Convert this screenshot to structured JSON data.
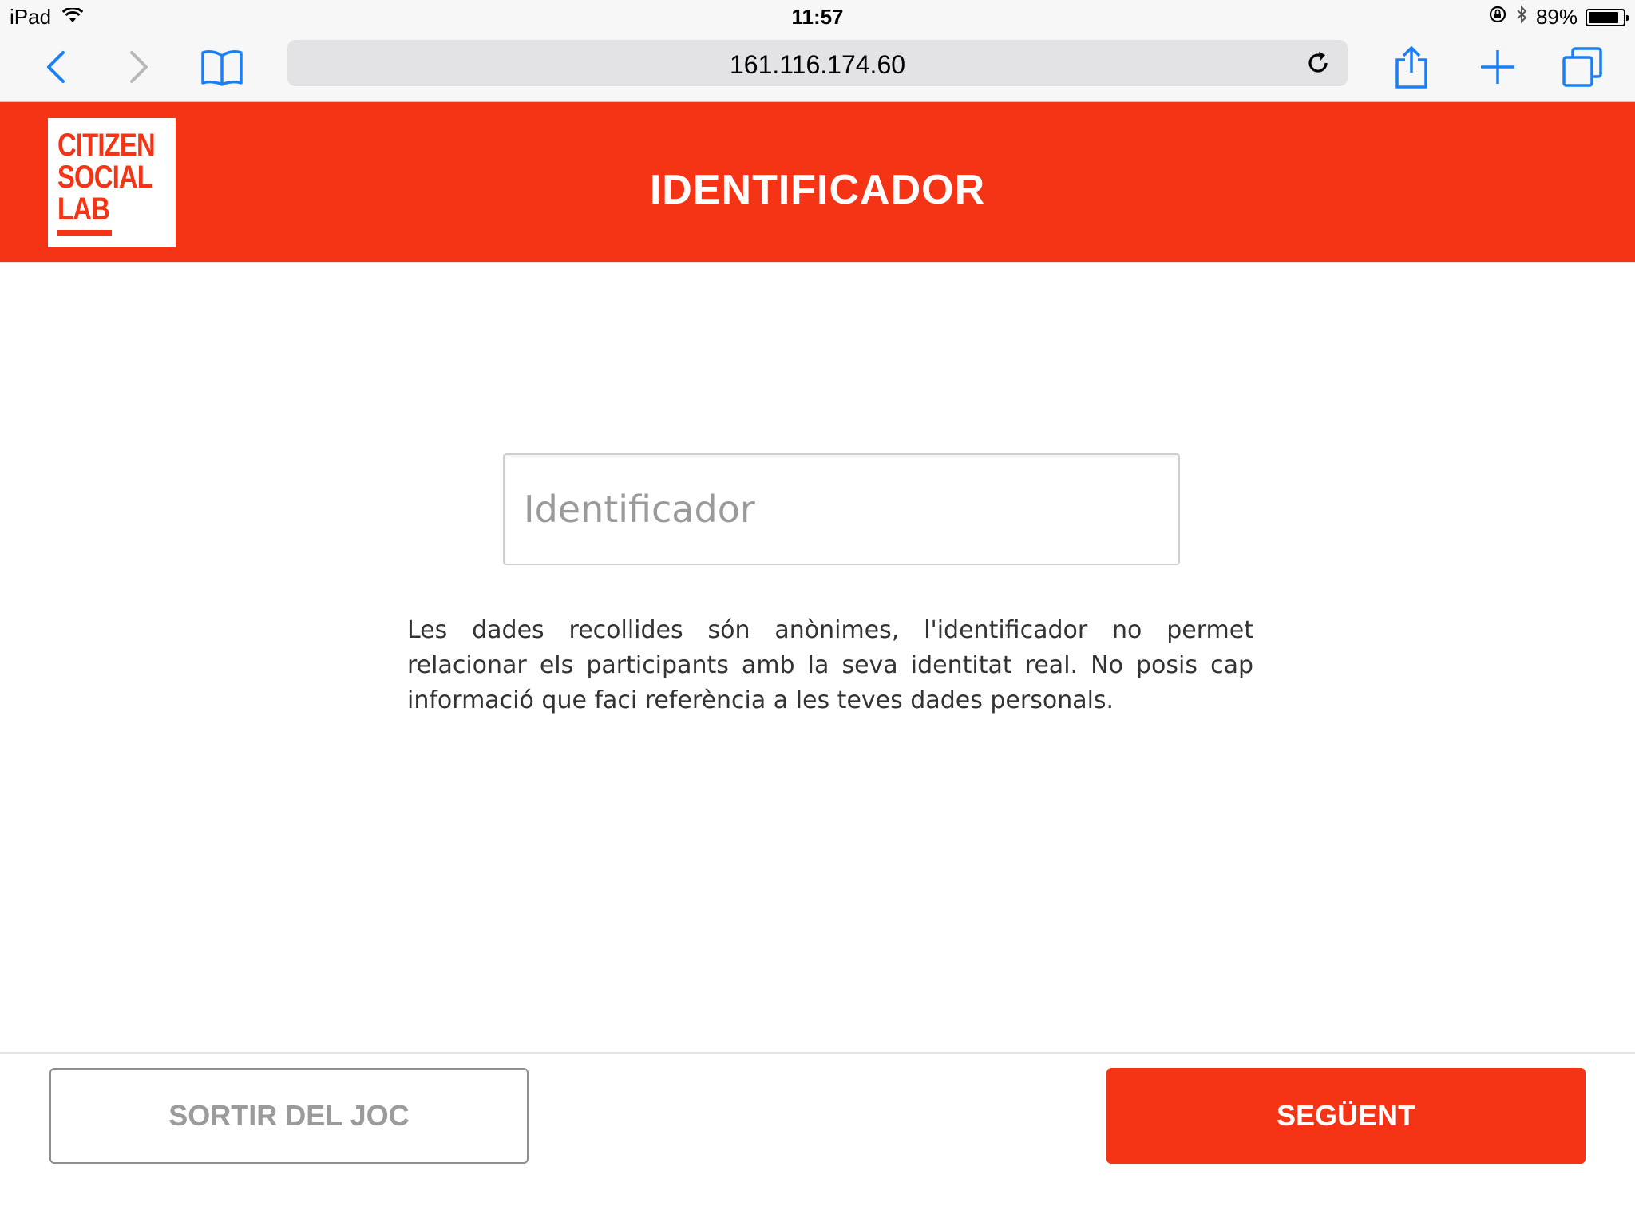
{
  "status_bar": {
    "device": "iPad",
    "time": "11:57",
    "battery": "89%",
    "battery_level": 0.89
  },
  "browser": {
    "url": "161.116.174.60",
    "icons": [
      "back-icon",
      "forward-icon",
      "bookmarks-icon",
      "reload-icon",
      "share-icon",
      "new-tab-icon",
      "tabs-icon"
    ]
  },
  "header": {
    "logo_lines": [
      "CITIZEN",
      "SOCIAL",
      "LAB"
    ],
    "title": "IDENTIFICADOR",
    "brand_color": "#f43414"
  },
  "main": {
    "identifier_placeholder": "Identificador",
    "identifier_value": "",
    "notice": "Les dades recollides són anònimes, l'identificador no permet relacionar els participants amb la seva identitat real. No posis cap informació que faci referència a les teves dades personals."
  },
  "footer": {
    "exit_label": "SORTIR DEL JOC",
    "next_label": "SEGÜENT"
  }
}
